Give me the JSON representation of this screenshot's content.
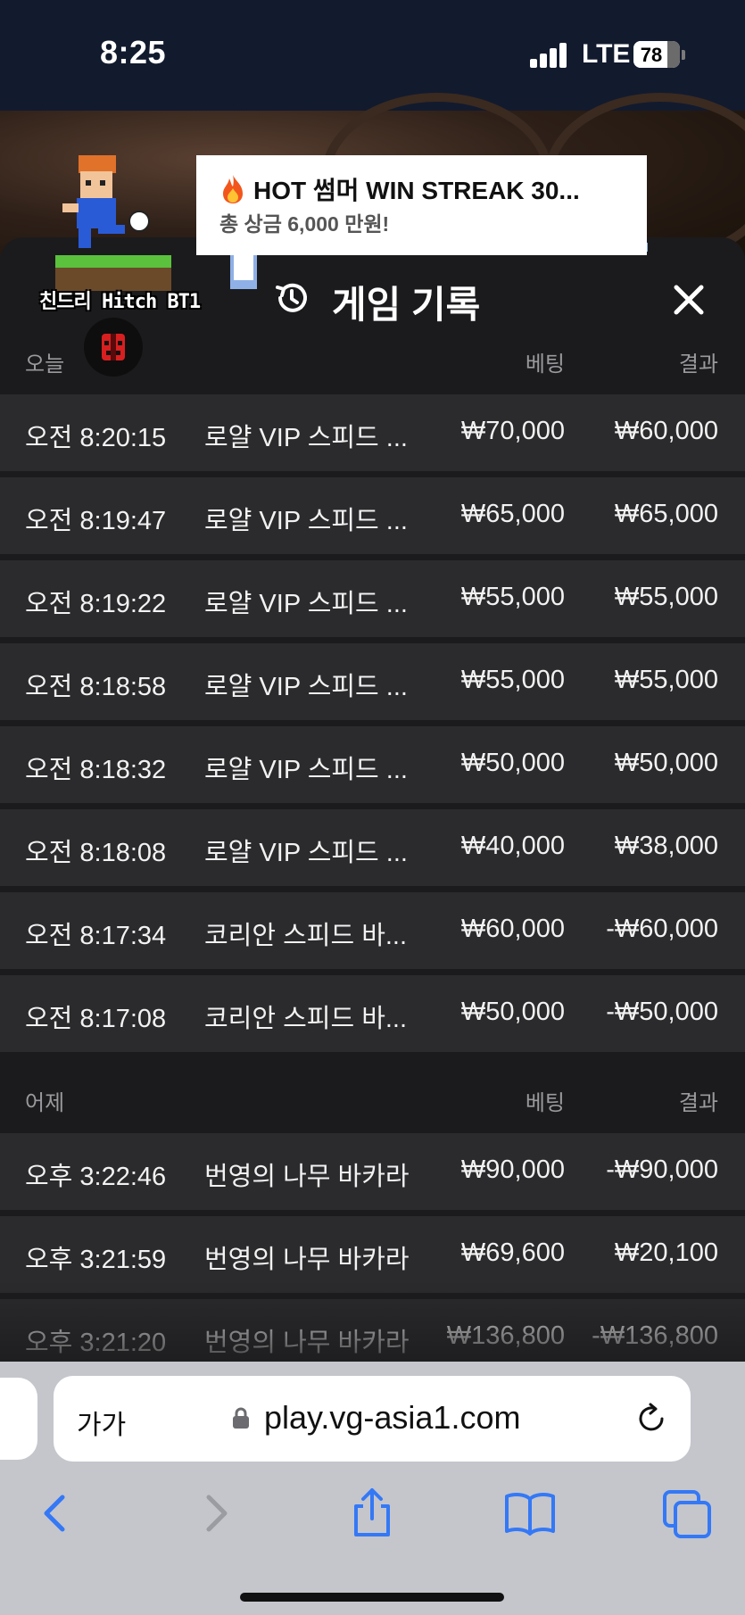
{
  "status_bar": {
    "time": "8:25",
    "network": "LTE",
    "battery": "78",
    "battery_level": 0.78
  },
  "promo": {
    "title": "HOT 썸머 WIN STREAK 30...",
    "subtitle": "총 상금 6,000 만원!",
    "mascot_text": "친드리 Hitch BT1"
  },
  "panel": {
    "title": "게임 기록"
  },
  "today": {
    "label": "오늘",
    "col_bet": "베팅",
    "col_result": "결과",
    "rows": [
      {
        "time": "오전 8:20:15",
        "game": "로얄 VIP 스피드 ...",
        "bet": "₩70,000",
        "result": "₩60,000"
      },
      {
        "time": "오전 8:19:47",
        "game": "로얄 VIP 스피드 ...",
        "bet": "₩65,000",
        "result": "₩65,000"
      },
      {
        "time": "오전 8:19:22",
        "game": "로얄 VIP 스피드 ...",
        "bet": "₩55,000",
        "result": "₩55,000"
      },
      {
        "time": "오전 8:18:58",
        "game": "로얄 VIP 스피드 ...",
        "bet": "₩55,000",
        "result": "₩55,000"
      },
      {
        "time": "오전 8:18:32",
        "game": "로얄 VIP 스피드 ...",
        "bet": "₩50,000",
        "result": "₩50,000"
      },
      {
        "time": "오전 8:18:08",
        "game": "로얄 VIP 스피드 ...",
        "bet": "₩40,000",
        "result": "₩38,000"
      },
      {
        "time": "오전 8:17:34",
        "game": "코리안 스피드 바...",
        "bet": "₩60,000",
        "result": "-₩60,000"
      },
      {
        "time": "오전 8:17:08",
        "game": "코리안 스피드 바...",
        "bet": "₩50,000",
        "result": "-₩50,000"
      }
    ]
  },
  "yesterday": {
    "label": "어제",
    "col_bet": "베팅",
    "col_result": "결과",
    "rows": [
      {
        "time": "오후 3:22:46",
        "game": "번영의 나무 바카라",
        "bet": "₩90,000",
        "result": "-₩90,000"
      },
      {
        "time": "오후 3:21:59",
        "game": "번영의 나무 바카라",
        "bet": "₩69,600",
        "result": "₩20,100"
      },
      {
        "time": "오후 3:21:20",
        "game": "번영의 나무 바카라",
        "bet": "₩136,800",
        "result": "-₩136,800"
      }
    ]
  },
  "browser": {
    "text_size_label": "가가",
    "url": "play.vg-asia1.com"
  },
  "icons": {
    "history": "history-icon",
    "close": "close-icon",
    "fire": "fire-icon",
    "lock": "lock-icon",
    "reload": "reload-icon",
    "back": "chevron-left-icon",
    "forward": "chevron-right-icon",
    "share": "share-icon",
    "bookmarks": "book-icon",
    "tabs": "tabs-icon"
  },
  "colors": {
    "panel": "#1b1b1d",
    "row": "#2b2b2d",
    "accent_blue": "#3478f6",
    "bubble_shadow": "#8fb0e6"
  }
}
